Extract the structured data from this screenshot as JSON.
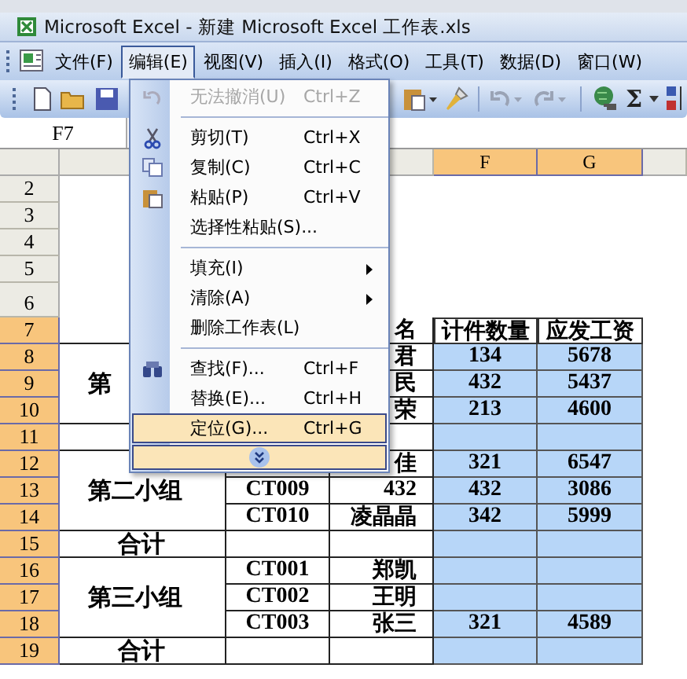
{
  "window": {
    "title": "Microsoft Excel - 新建 Microsoft Excel 工作表.xls"
  },
  "menu_bar": [
    {
      "label": "文件(F)",
      "selected": false
    },
    {
      "label": "编辑(E)",
      "selected": true
    },
    {
      "label": "视图(V)",
      "selected": false
    },
    {
      "label": "插入(I)",
      "selected": false
    },
    {
      "label": "格式(O)",
      "selected": false
    },
    {
      "label": "工具(T)",
      "selected": false
    },
    {
      "label": "数据(D)",
      "selected": false
    },
    {
      "label": "窗口(W)",
      "selected": false
    }
  ],
  "toolbar": {
    "sum_symbol": "Σ"
  },
  "name_box": {
    "value": "F7"
  },
  "edit_menu": [
    {
      "kind": "command",
      "label": "无法撤消(U)",
      "shortcut": "Ctrl+Z",
      "disabled": true,
      "selected": false
    },
    {
      "kind": "separator"
    },
    {
      "kind": "command",
      "label": "剪切(T)",
      "shortcut": "Ctrl+X",
      "disabled": false,
      "selected": false
    },
    {
      "kind": "command",
      "label": "复制(C)",
      "shortcut": "Ctrl+C",
      "disabled": false,
      "selected": false
    },
    {
      "kind": "command",
      "label": "粘贴(P)",
      "shortcut": "Ctrl+V",
      "disabled": false,
      "selected": false
    },
    {
      "kind": "command",
      "label": "选择性粘贴(S)...",
      "disabled": false,
      "selected": false
    },
    {
      "kind": "separator"
    },
    {
      "kind": "command",
      "label": "填充(I)",
      "submenu": true,
      "disabled": false,
      "selected": false
    },
    {
      "kind": "command",
      "label": "清除(A)",
      "submenu": true,
      "disabled": false,
      "selected": false
    },
    {
      "kind": "command",
      "label": "删除工作表(L)",
      "disabled": false,
      "selected": false
    },
    {
      "kind": "separator"
    },
    {
      "kind": "command",
      "label": "查找(F)...",
      "shortcut": "Ctrl+F",
      "disabled": false,
      "selected": false
    },
    {
      "kind": "command",
      "label": "替换(E)...",
      "shortcut": "Ctrl+H",
      "disabled": false,
      "selected": false
    },
    {
      "kind": "command",
      "label": "定位(G)...",
      "shortcut": "Ctrl+G",
      "disabled": false,
      "selected": true
    },
    {
      "kind": "expand",
      "selected": true
    }
  ],
  "sheet": {
    "columns": [
      {
        "label": "F",
        "selected": true
      },
      {
        "label": "G",
        "selected": true
      }
    ],
    "row_headers": [
      {
        "label": "2",
        "selected": false
      },
      {
        "label": "3",
        "selected": false
      },
      {
        "label": "4",
        "selected": false
      },
      {
        "label": "5",
        "selected": false
      },
      {
        "label": "6",
        "selected": false
      },
      {
        "label": "7",
        "selected": true
      },
      {
        "label": "8",
        "selected": true
      },
      {
        "label": "9",
        "selected": true
      },
      {
        "label": "10",
        "selected": true
      },
      {
        "label": "11",
        "selected": true
      },
      {
        "label": "12",
        "selected": true
      },
      {
        "label": "13",
        "selected": true
      },
      {
        "label": "14",
        "selected": true
      },
      {
        "label": "15",
        "selected": true
      },
      {
        "label": "16",
        "selected": true
      },
      {
        "label": "17",
        "selected": true
      },
      {
        "label": "18",
        "selected": true
      },
      {
        "label": "19",
        "selected": true
      }
    ],
    "table_header": [
      "名",
      "计件数量",
      "应发工资"
    ],
    "sections": [
      {
        "kind": "group",
        "label": "第",
        "rows": [
          [
            null,
            "君",
            "134",
            "5678"
          ],
          [
            null,
            "民",
            "432",
            "5437"
          ],
          [
            null,
            "荣",
            "213",
            "4600"
          ]
        ]
      },
      {
        "kind": "total"
      },
      {
        "kind": "group",
        "label": "第二小组",
        "rows": [
          [
            null,
            "佳",
            "321",
            "6547"
          ],
          [
            "CT009",
            "432",
            "432",
            "3086"
          ],
          [
            "CT010",
            "凌晶晶",
            "342",
            "5999"
          ]
        ]
      },
      {
        "kind": "total",
        "label": "合计"
      },
      {
        "kind": "group",
        "label": "第三小组",
        "rows": [
          [
            "CT001",
            "郑凯",
            null,
            null
          ],
          [
            "CT002",
            "王明",
            null,
            null
          ],
          [
            "CT003",
            "张三",
            "321",
            "4589"
          ]
        ]
      },
      {
        "kind": "total",
        "label": "合计"
      }
    ]
  }
}
